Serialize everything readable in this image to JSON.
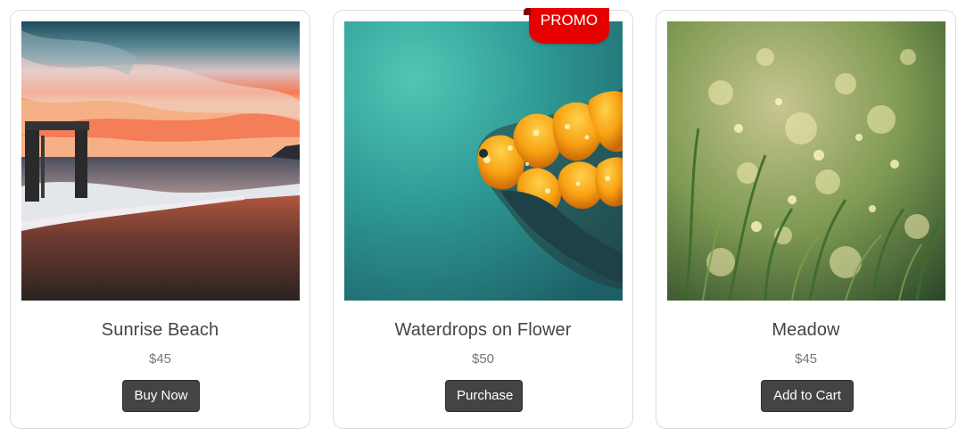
{
  "products": [
    {
      "title": "Sunrise Beach",
      "price": "$45",
      "button_label": "Buy Now",
      "image_icon": "sunrise-beach-photo"
    },
    {
      "title": "Waterdrops on Flower",
      "price": "$50",
      "button_label": "Purchase",
      "badge": "PROMO",
      "image_icon": "waterdrops-flower-photo"
    },
    {
      "title": "Meadow",
      "price": "$45",
      "button_label": "Add to Cart",
      "image_icon": "meadow-photo"
    }
  ],
  "colors": {
    "button_bg": "#444444",
    "badge_bg": "#e60000",
    "title_text": "#444444",
    "price_text": "#777777"
  }
}
